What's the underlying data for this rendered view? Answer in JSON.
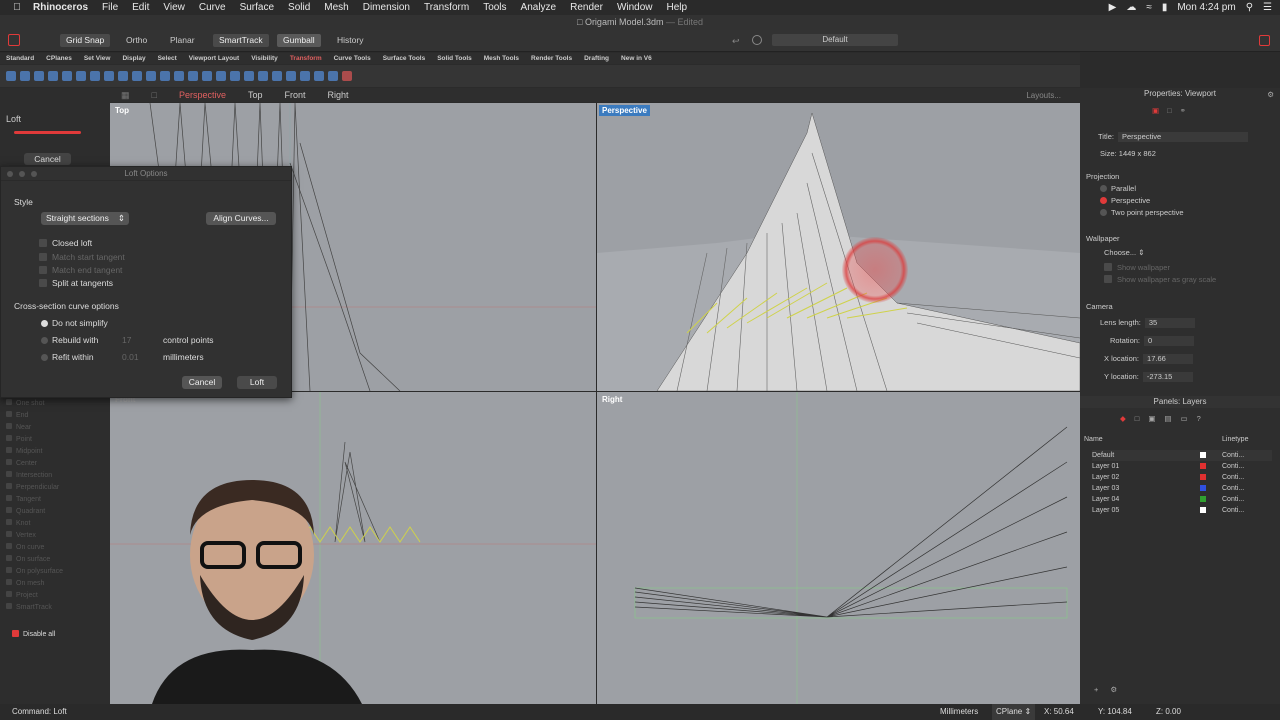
{
  "menubar": {
    "app": "Rhinoceros",
    "items": [
      "File",
      "Edit",
      "View",
      "Curve",
      "Surface",
      "Solid",
      "Mesh",
      "Dimension",
      "Transform",
      "Tools",
      "Analyze",
      "Render",
      "Window",
      "Help"
    ],
    "clock": "Mon 4:24 pm"
  },
  "window": {
    "title": "Origami Model.3dm",
    "edited": " — Edited"
  },
  "toolbar": {
    "grid_snap": "Grid Snap",
    "ortho": "Ortho",
    "planar": "Planar",
    "smarttrack": "SmartTrack",
    "gumball": "Gumball",
    "history": "History",
    "layer_default": "Default"
  },
  "tool_tabs": [
    "Standard",
    "CPlanes",
    "Set View",
    "Display",
    "Select",
    "Viewport Layout",
    "Visibility",
    "Transform",
    "Curve Tools",
    "Surface Tools",
    "Solid Tools",
    "Mesh Tools",
    "Render Tools",
    "Drafting",
    "New in V6"
  ],
  "selected_tool_tab": "Transform",
  "command_panel": {
    "title": "Loft",
    "cancel": "Cancel"
  },
  "osnaps": [
    "One shot",
    "End",
    "Near",
    "Point",
    "Midpoint",
    "Center",
    "Intersection",
    "Perpendicular",
    "Tangent",
    "Quadrant",
    "Knot",
    "Vertex",
    "On curve",
    "On surface",
    "On polysurface",
    "On mesh",
    "Project",
    "SmartTrack"
  ],
  "disable_all": "Disable all",
  "viewport_tabs": [
    "Perspective",
    "Top",
    "Front",
    "Right"
  ],
  "layouts_label": "Layouts...",
  "viewports": {
    "top": "Top",
    "perspective": "Perspective",
    "front": "Front",
    "right": "Right"
  },
  "loft_dialog": {
    "title": "Loft Options",
    "style_label": "Style",
    "style_value": "Straight sections",
    "align_curves": "Align Curves...",
    "closed_loft": "Closed loft",
    "match_start": "Match start tangent",
    "match_end": "Match end tangent",
    "split_tangents": "Split at tangents",
    "cross_section_label": "Cross-section curve options",
    "do_not_simplify": "Do not simplify",
    "rebuild_with": "Rebuild with",
    "rebuild_value": "17",
    "control_points": "control points",
    "refit_within": "Refit within",
    "refit_value": "0.01",
    "millimeters": "millimeters",
    "cancel": "Cancel",
    "loft": "Loft"
  },
  "properties": {
    "header": "Properties: Viewport",
    "title_label": "Title:",
    "title_value": "Perspective",
    "size_label": "Size:",
    "size_value": "1449 x 862",
    "projection_label": "Projection",
    "parallel": "Parallel",
    "perspective": "Perspective",
    "two_point": "Two point perspective",
    "wallpaper_label": "Wallpaper",
    "choose": "Choose...",
    "show_wallpaper": "Show wallpaper",
    "show_gray": "Show wallpaper as gray scale",
    "camera_label": "Camera",
    "lens_label": "Lens length:",
    "lens_value": "35",
    "rotation_label": "Rotation:",
    "rotation_value": "0",
    "xloc_label": "X location:",
    "xloc_value": "17.66",
    "yloc_label": "Y location:",
    "yloc_value": "-273.15"
  },
  "layers": {
    "header": "Panels: Layers",
    "col_name": "Name",
    "col_linetype": "Linetype",
    "rows": [
      {
        "name": "Default",
        "color": "#ffffff",
        "linetype": "Conti..."
      },
      {
        "name": "Layer 01",
        "color": "#e03030",
        "linetype": "Conti..."
      },
      {
        "name": "Layer 02",
        "color": "#e03030",
        "linetype": "Conti..."
      },
      {
        "name": "Layer 03",
        "color": "#3050e0",
        "linetype": "Conti..."
      },
      {
        "name": "Layer 04",
        "color": "#30a030",
        "linetype": "Conti..."
      },
      {
        "name": "Layer 05",
        "color": "#ffffff",
        "linetype": "Conti..."
      }
    ]
  },
  "status": {
    "command": "Command: Loft",
    "units": "Millimeters",
    "cplane": "CPlane",
    "x": "X: 50.64",
    "y": "Y: 104.84",
    "z": "Z: 0.00"
  }
}
